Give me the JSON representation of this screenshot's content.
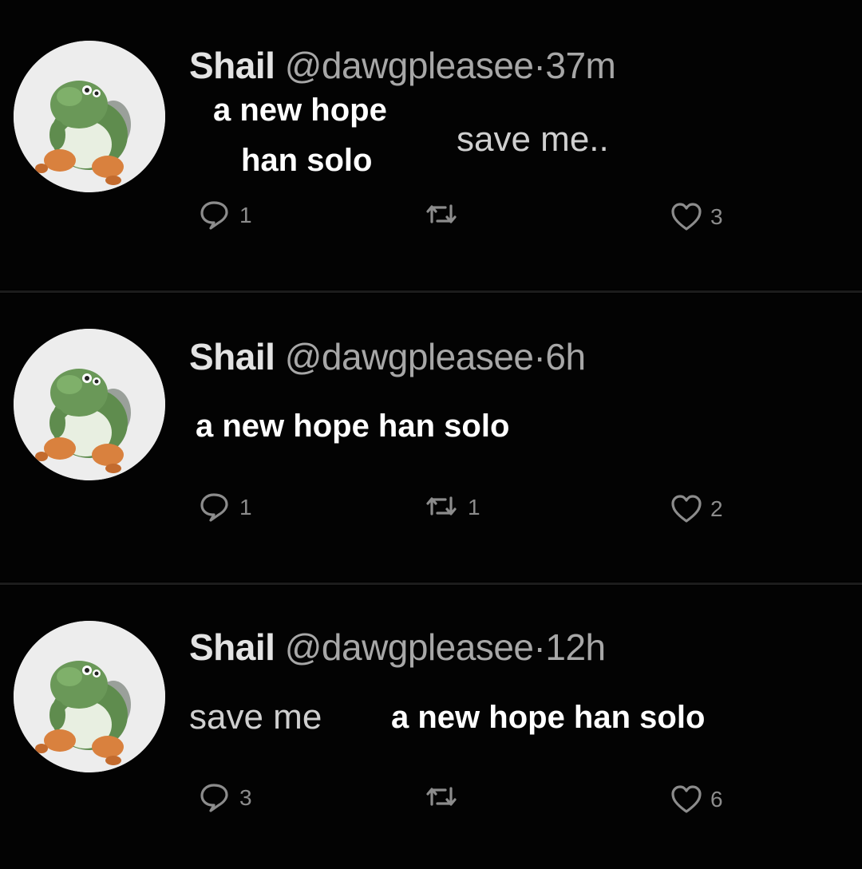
{
  "tweets": [
    {
      "name": "Shail",
      "handle": "@dawgpleasee",
      "separator": "·",
      "time": "37m",
      "overlay_text": [
        "a new hope",
        "han solo"
      ],
      "text": "save me..",
      "replies": "1",
      "retweets": "",
      "likes": "3"
    },
    {
      "name": "Shail",
      "handle": "@dawgpleasee",
      "separator": "·",
      "time": "6h",
      "overlay_text": [
        "a new hope han solo"
      ],
      "text": "",
      "replies": "1",
      "retweets": "1",
      "likes": "2"
    },
    {
      "name": "Shail",
      "handle": "@dawgpleasee",
      "separator": "·",
      "time": "12h",
      "overlay_text": [
        "a new hope han solo"
      ],
      "text": "save me",
      "replies": "3",
      "retweets": "",
      "likes": "6"
    }
  ],
  "icons": {
    "reply": "reply-icon",
    "retweet": "retweet-icon",
    "like": "heart-icon",
    "avatar": "yoshi-avatar"
  },
  "colors": {
    "background": "#000000",
    "avatar_bg": "#ededed",
    "muted": "#a7a7a7"
  }
}
